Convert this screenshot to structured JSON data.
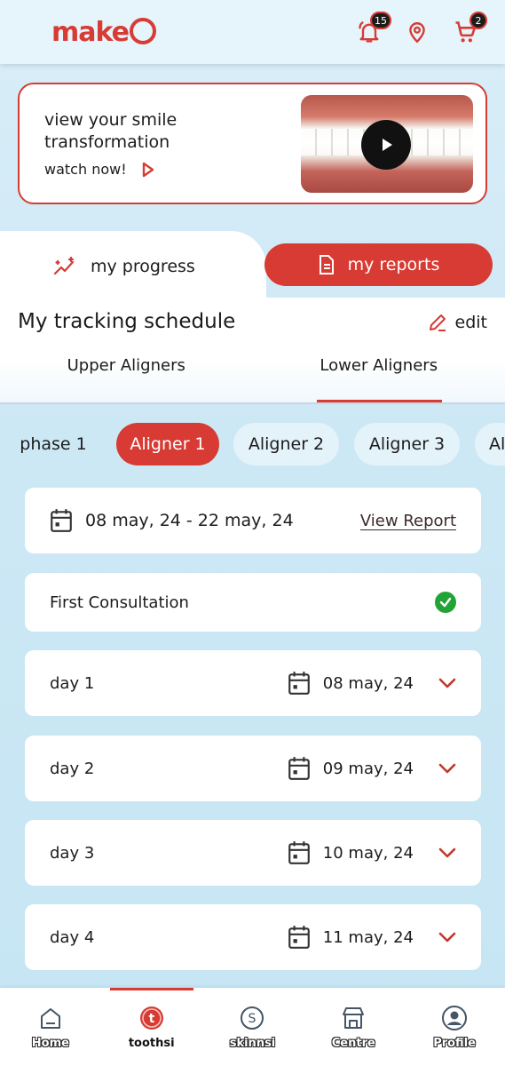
{
  "header": {
    "logo_text": "make",
    "notifications_badge": "15",
    "cart_badge": "2",
    "brand_color": "#d73b34"
  },
  "banner": {
    "title": "view your smile transformation",
    "cta": "watch now!"
  },
  "tabs": {
    "progress_label": "my progress",
    "reports_label": "my reports"
  },
  "schedule": {
    "title": "My tracking schedule",
    "edit_label": "edit",
    "aligner_tabs": [
      "Upper Aligners",
      "Lower Aligners"
    ],
    "active_aligner_tab": "Lower Aligners"
  },
  "phases": {
    "items": [
      "phase 1",
      "Aligner 1",
      "Aligner 2",
      "Aligner 3",
      "Al"
    ],
    "active": "Aligner 1"
  },
  "range_card": {
    "dates": "08 may, 24 - 22 may, 24",
    "link": "View Report"
  },
  "consultation": {
    "label": "First Consultation",
    "status": "completed"
  },
  "days": [
    {
      "label": "day 1",
      "date": "08 may, 24"
    },
    {
      "label": "day 2",
      "date": "09 may, 24"
    },
    {
      "label": "day 3",
      "date": "10 may, 24"
    },
    {
      "label": "day 4",
      "date": "11 may, 24"
    }
  ],
  "bottom_nav": [
    {
      "label": "Home",
      "icon": "home-icon"
    },
    {
      "label": "toothsi",
      "icon": "toothsi-icon"
    },
    {
      "label": "skinnsi",
      "icon": "skinnsi-icon"
    },
    {
      "label": "Centre",
      "icon": "store-icon"
    },
    {
      "label": "Profile",
      "icon": "profile-icon"
    }
  ],
  "active_nav": "toothsi"
}
